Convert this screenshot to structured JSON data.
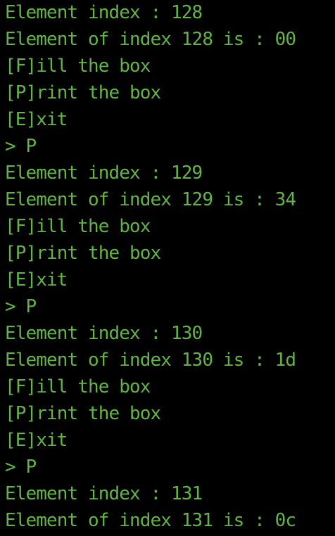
{
  "terminal": {
    "text_color": "#62b544",
    "background_color": "#000000",
    "lines": [
      "Element index : 128",
      "Element of index 128 is : 00",
      "[F]ill the box",
      "[P]rint the box",
      "[E]xit",
      "> P",
      "Element index : 129",
      "Element of index 129 is : 34",
      "[F]ill the box",
      "[P]rint the box",
      "[E]xit",
      "> P",
      "Element index : 130",
      "Element of index 130 is : 1d",
      "[F]ill the box",
      "[P]rint the box",
      "[E]xit",
      "> P",
      "Element index : 131",
      "Element of index 131 is : 0c"
    ]
  }
}
